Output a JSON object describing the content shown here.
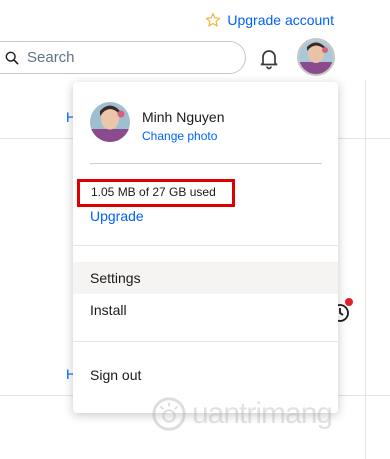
{
  "topbar": {
    "upgrade_label": "Upgrade account",
    "search": {
      "placeholder": "Search"
    }
  },
  "background": {
    "link_fragment_1": "H",
    "link_fragment_2": "H"
  },
  "account_menu": {
    "user_name": "Minh Nguyen",
    "change_photo_label": "Change photo",
    "storage_usage": "1.05 MB of 27 GB used",
    "upgrade_label": "Upgrade",
    "items": [
      {
        "label": "Settings",
        "highlighted": true
      },
      {
        "label": "Install",
        "highlighted": false
      },
      {
        "label": "Sign out",
        "highlighted": false
      }
    ]
  },
  "watermark": {
    "text": "uantrimang"
  },
  "colors": {
    "link_blue": "#0061fe",
    "highlight_red": "#e00000",
    "star_gold": "#f0b43c",
    "notification_red": "#e0212a"
  }
}
